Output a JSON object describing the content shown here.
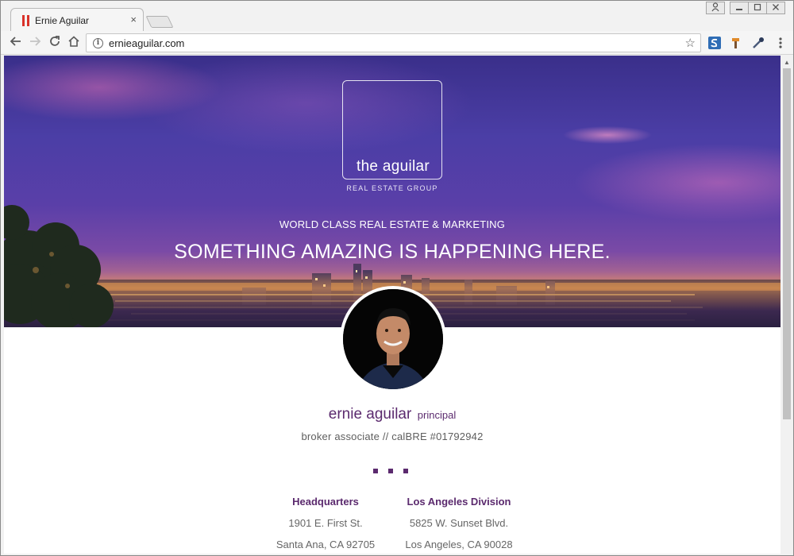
{
  "browser": {
    "tab_title": "Ernie Aguilar",
    "tab_close": "×",
    "url": "ernieaguilar.com"
  },
  "hero": {
    "logo_name": "the aguilar",
    "logo_sub": "REAL ESTATE GROUP",
    "tagline": "WORLD CLASS REAL ESTATE & MARKETING",
    "headline": "SOMETHING AMAZING IS HAPPENING HERE."
  },
  "profile": {
    "name": "ernie aguilar",
    "role": "principal",
    "license": "broker associate // calBRE #01792942"
  },
  "offices": [
    {
      "title": "Headquarters",
      "street": "1901 E. First St.",
      "city": "Santa Ana, CA 92705"
    },
    {
      "title": "Los Angeles Division",
      "street": "5825 W. Sunset Blvd.",
      "city": "Los Angeles, CA 90028"
    }
  ],
  "colors": {
    "accent_purple": "#5b2a6e",
    "favicon_red": "#d9322a"
  }
}
